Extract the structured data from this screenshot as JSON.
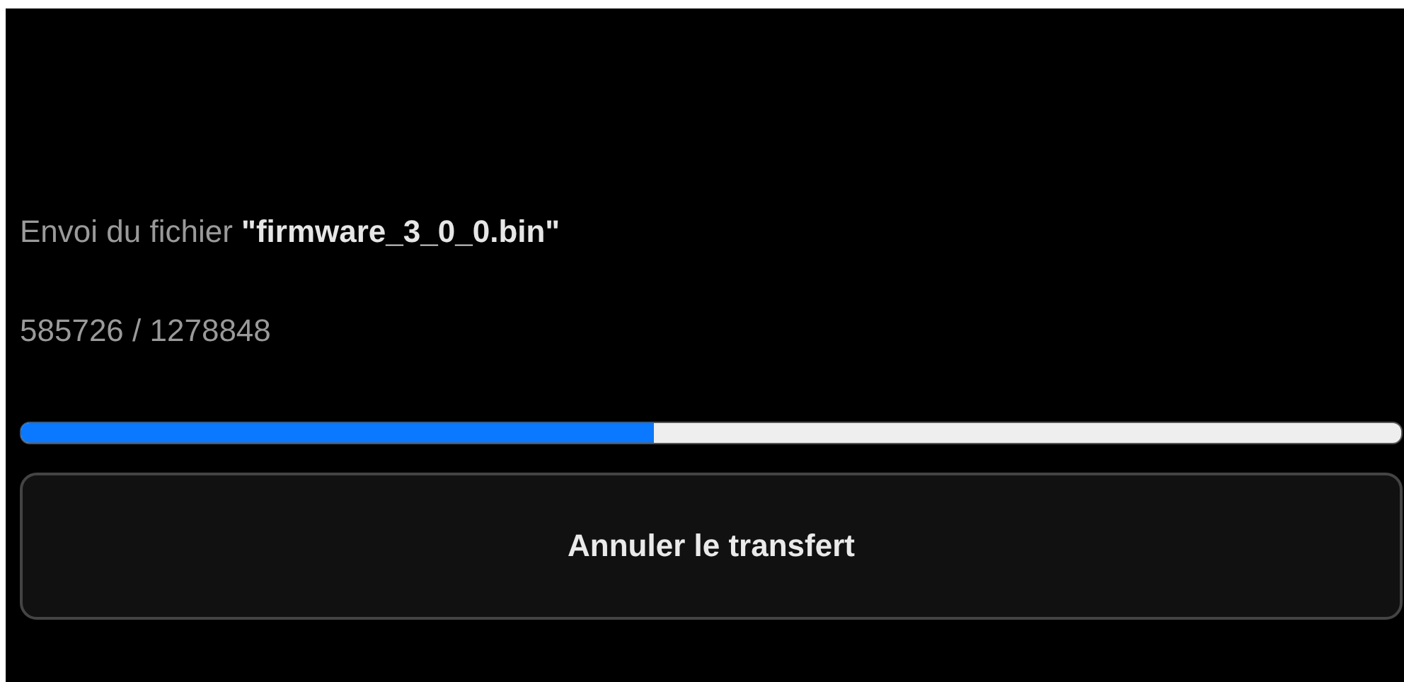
{
  "status": "Envoi du fichier **\"firmware_3_0_0.bin\"**",
  "progress_text": "585726 / 1278848",
  "progress": {
    "level": 0.458
  },
  "cancel_button": {
    "label": "Annuler le transfert"
  }
}
